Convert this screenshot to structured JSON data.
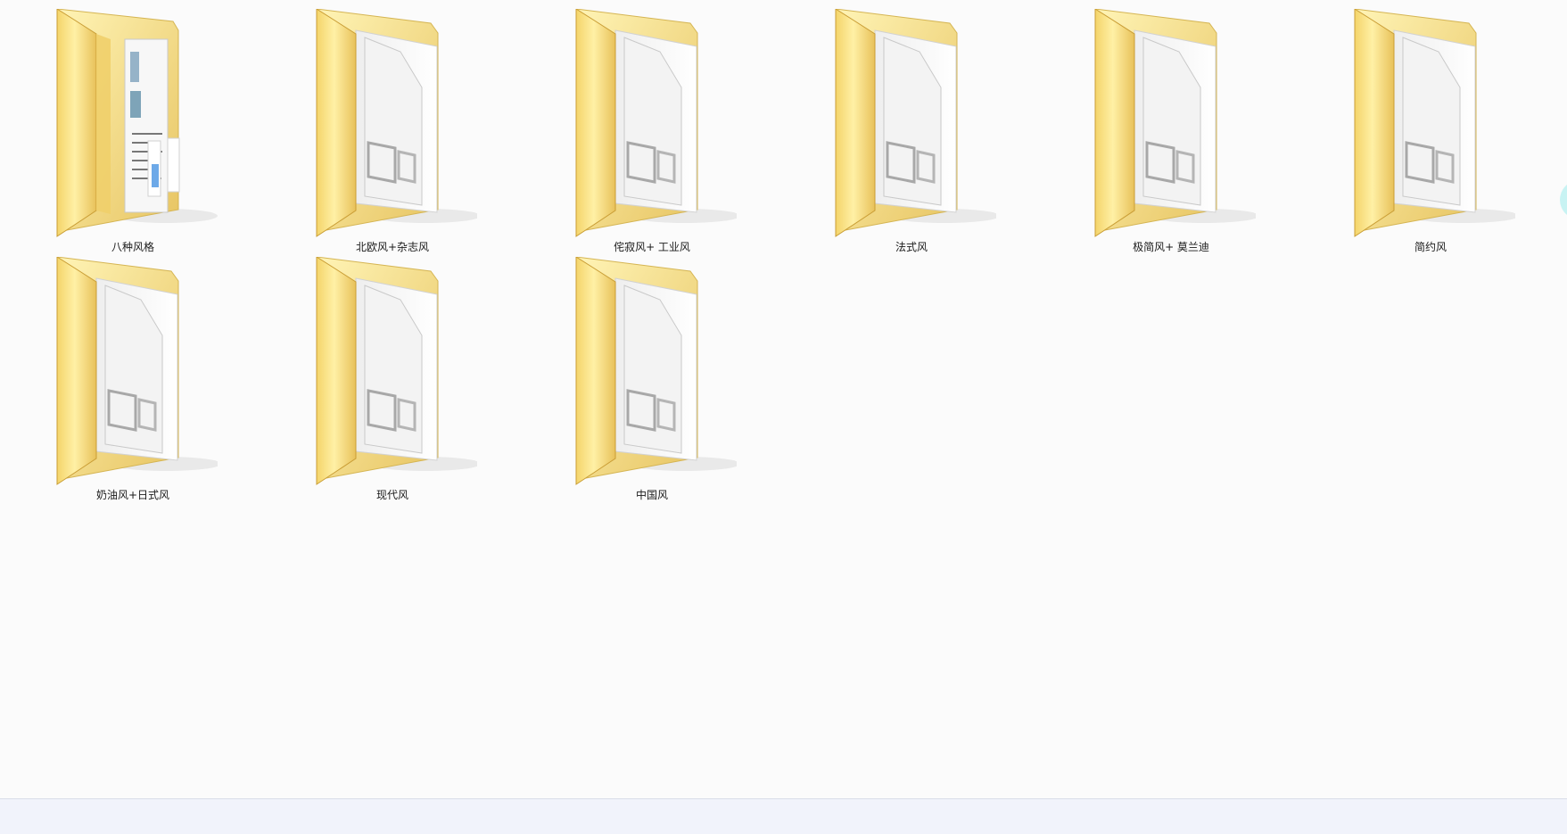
{
  "folders": [
    {
      "label": "八种风格",
      "preview": "document-pages"
    },
    {
      "label": "北欧风+杂志风",
      "preview": "blank-pages"
    },
    {
      "label": "侘寂风+ 工业风",
      "preview": "blank-pages"
    },
    {
      "label": "法式风",
      "preview": "blank-pages"
    },
    {
      "label": "极简风+ 莫兰迪",
      "preview": "blank-pages"
    },
    {
      "label": "简约风",
      "preview": "blank-pages"
    },
    {
      "label": "奶油风+日式风",
      "preview": "blank-pages"
    },
    {
      "label": "现代风",
      "preview": "blank-pages"
    },
    {
      "label": "中国风",
      "preview": "blank-pages"
    }
  ],
  "icons": {
    "folder": "folder-icon"
  },
  "colors": {
    "background": "#fbfbfb",
    "folder_yellow": "#f2d36b",
    "status_bar": "#f1f3fb",
    "edge_accent": "#c8f3f3"
  }
}
